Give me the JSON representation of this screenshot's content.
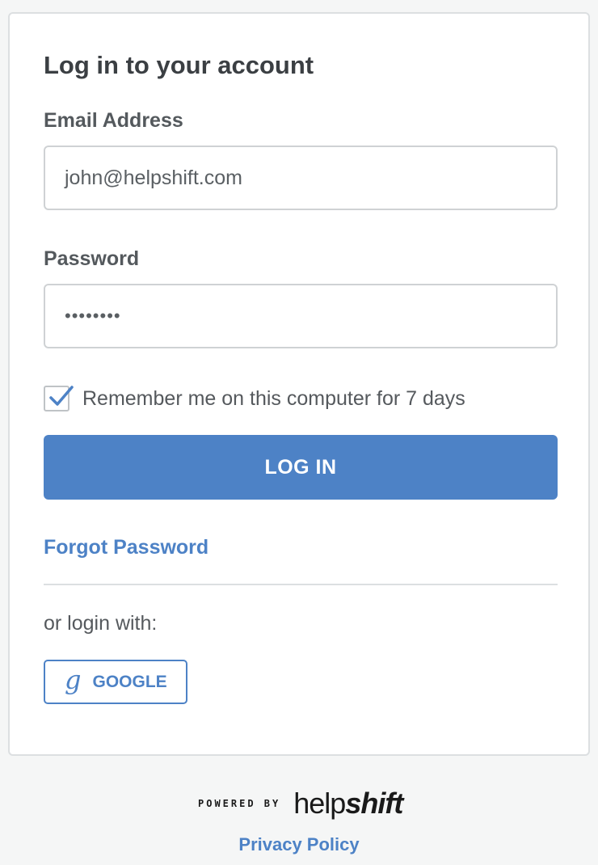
{
  "login": {
    "title": "Log in to your account",
    "email_label": "Email Address",
    "email_value": "john@helpshift.com",
    "password_label": "Password",
    "password_value": "••••••••",
    "remember_label": "Remember me on this computer for 7 days",
    "remember_checked": true,
    "login_button": "LOG IN",
    "forgot_link": "Forgot Password",
    "or_text": "or login with:",
    "google_icon": "g",
    "google_button": "GOOGLE"
  },
  "footer": {
    "powered_by": "POWERED BY",
    "brand_thin": "help",
    "brand_bold": "shift",
    "privacy_link": "Privacy Policy"
  },
  "colors": {
    "accent": "#4d82c6",
    "background": "#f5f6f6",
    "card": "#ffffff",
    "border": "#dcdfe1"
  }
}
